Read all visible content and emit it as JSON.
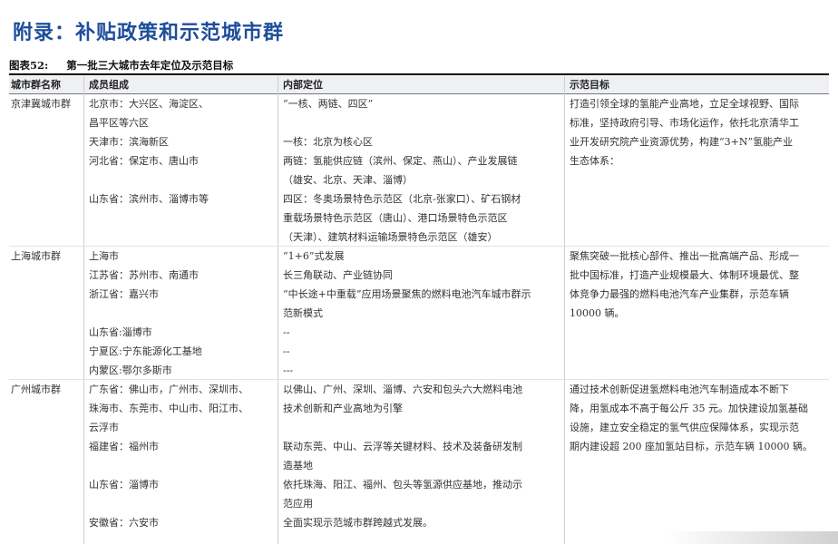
{
  "title": "附录：补贴政策和示范城市群",
  "caption": {
    "number": "图表52:",
    "text": "第一批三大城市去年定位及示范目标"
  },
  "headers": [
    "城市群名称",
    "成员组成",
    "内部定位",
    "示范目标"
  ],
  "rows": [
    {
      "group": "京津冀城市群",
      "members": [
        "北京市：大兴区、海淀区、",
        "昌平区等六区"
      ],
      "position": [
        "“一核、两链、四区”"
      ]
    },
    {
      "members": [
        "天津市：滨海新区"
      ],
      "position": [
        "一核：北京为核心区"
      ]
    },
    {
      "members": [
        "河北省：保定市、唐山市"
      ],
      "position": [
        "两链：氢能供应链（滨州、保定、燕山）、产业发展链",
        "（雄安、北京、天津、淄博）"
      ]
    },
    {
      "members": [
        "山东省：滨州市、淄博市等"
      ],
      "position": [
        "四区：冬奥场景特色示范区（北京-张家口）、矿石钢材",
        "重载场景特色示范区（唐山）、港口场景特色示范区",
        "（天津）、建筑材料运输场景特色示范区（雄安）"
      ]
    },
    {
      "group": "上海城市群",
      "members": [
        "上海市"
      ],
      "position": [
        "“1+6”式发展"
      ]
    },
    {
      "members": [
        "江苏省：苏州市、南通市"
      ],
      "position": [
        "长三角联动、产业链协同"
      ]
    },
    {
      "members": [
        "浙江省：嘉兴市"
      ],
      "position": [
        "“中长途+中重载”应用场景聚焦的燃料电池汽车城市群示",
        "范新模式"
      ]
    },
    {
      "members": [
        "山东省:淄博市"
      ],
      "position": [
        "--"
      ]
    },
    {
      "members": [
        "宁夏区:宁东能源化工基地"
      ],
      "position": [
        "--"
      ]
    },
    {
      "members": [
        "内蒙区:鄂尔多斯市"
      ],
      "position": [
        "---"
      ]
    },
    {
      "group": "广州城市群",
      "members": [
        "广东省：佛山市，广州市、深圳市、",
        "珠海市、东莞市、中山市、阳江市、",
        "云浮市"
      ],
      "position": [
        "以佛山、广州、深圳、淄博、六安和包头六大燃料电池",
        "技术创新和产业高地为引擎"
      ]
    },
    {
      "members": [
        "福建省：福州市"
      ],
      "position": [
        "联动东莞、中山、云浮等关键材料、技术及装备研发制",
        "造基地"
      ]
    },
    {
      "members": [
        "山东省：淄博市"
      ],
      "position": [
        "依托珠海、阳江、福州、包头等氢源供应基地，推动示",
        "范应用"
      ]
    },
    {
      "members": [
        "安徽省：六安市"
      ],
      "position": [
        "全面实现示范城市群跨越式发展。"
      ]
    }
  ],
  "targets": [
    [
      "打造引领全球的氢能产业高地，立足全球视野、国际",
      "标准，坚持政府引导、市场化运作，依托北京清华工",
      "业开发研究院产业资源优势，构建“3+N”氢能产业",
      "生态体系："
    ],
    [
      "聚焦突破一批核心部件、推出一批高端产品、形成一",
      "批中国标准，打造产业规模最大、体制环境最优、整",
      "体竞争力最强的燃料电池汽车产业集群，示范车辆",
      "10000 辆。"
    ],
    [
      "通过技术创新促进氢燃料电池汽车制造成本不断下",
      "降，用氢成本不高于每公斤 35 元。加快建设加氢基础",
      "设施，建立安全稳定的氢气供应保障体系，实现示范",
      "期内建设超 200 座加氢站目标，示范车辆 10000 辆。"
    ]
  ]
}
